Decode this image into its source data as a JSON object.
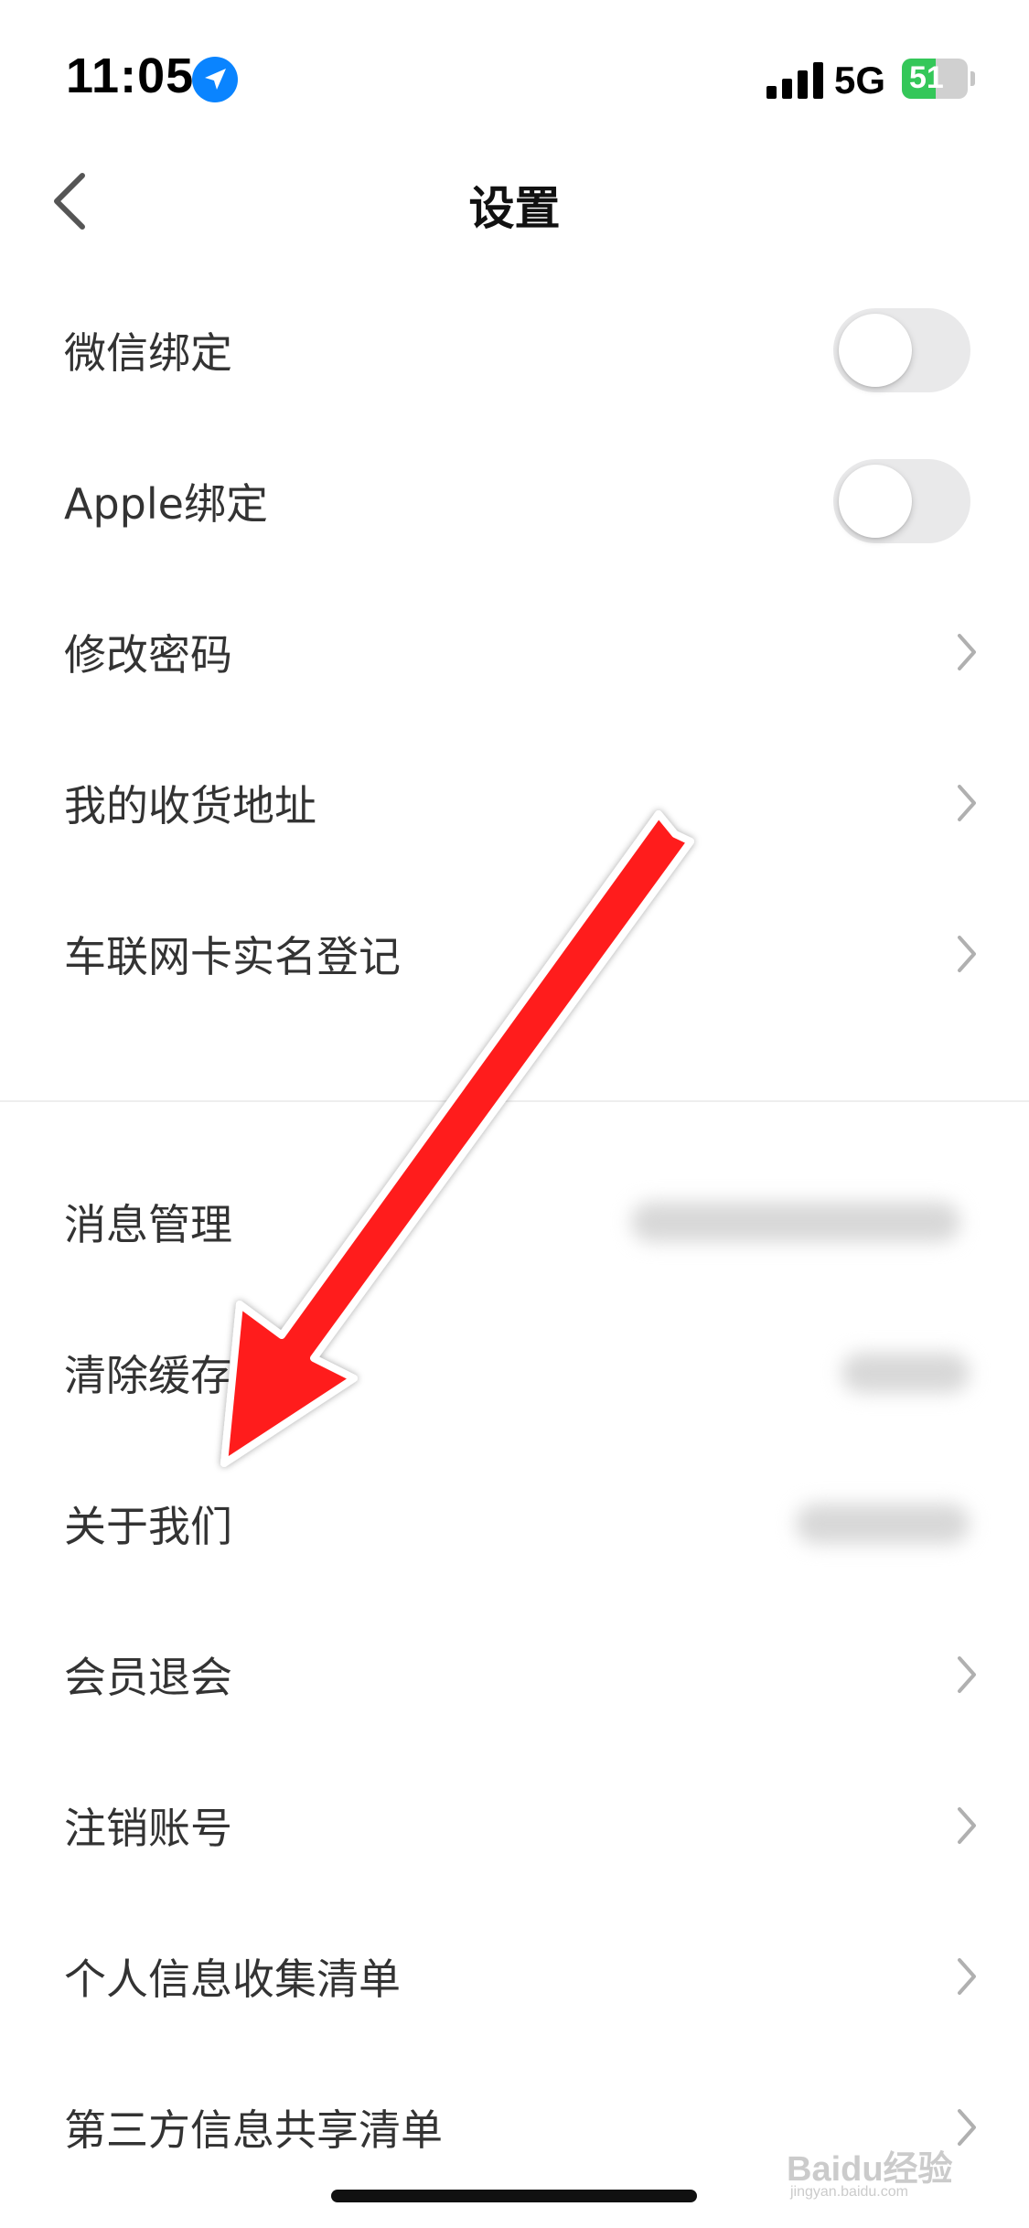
{
  "status_bar": {
    "time": "11:05",
    "network": "5G",
    "battery_percent": 51,
    "battery_label": "51"
  },
  "nav": {
    "title": "设置"
  },
  "rows": [
    {
      "label": "微信绑定",
      "accessory": "toggle",
      "on": false
    },
    {
      "label": "Apple绑定",
      "accessory": "toggle",
      "on": false
    },
    {
      "label": "修改密码",
      "accessory": "chevron"
    },
    {
      "label": "我的收货地址",
      "accessory": "chevron"
    },
    {
      "label": "车联网卡实名登记",
      "accessory": "chevron"
    },
    {
      "label": "消息管理",
      "accessory": "blurred"
    },
    {
      "label": "清除缓存",
      "accessory": "blurred"
    },
    {
      "label": "关于我们",
      "accessory": "blurred"
    },
    {
      "label": "会员退会",
      "accessory": "chevron"
    },
    {
      "label": "注销账号",
      "accessory": "chevron"
    },
    {
      "label": "个人信息收集清单",
      "accessory": "chevron"
    },
    {
      "label": "第三方信息共享清单",
      "accessory": "chevron"
    }
  ],
  "icons": {
    "back": "chevron-left-icon",
    "location": "location-arrow-icon",
    "signal": "signal-bars-icon",
    "battery": "battery-icon",
    "row_chevron": "chevron-right-icon"
  },
  "colors": {
    "arrow": "#ff1a1a",
    "toggle_off": "#e9e9ea",
    "battery_fill": "#34c759",
    "location": "#0a84ff"
  },
  "watermark": {
    "text": "Baidu经验",
    "sub": "jingyan.baidu.com"
  }
}
